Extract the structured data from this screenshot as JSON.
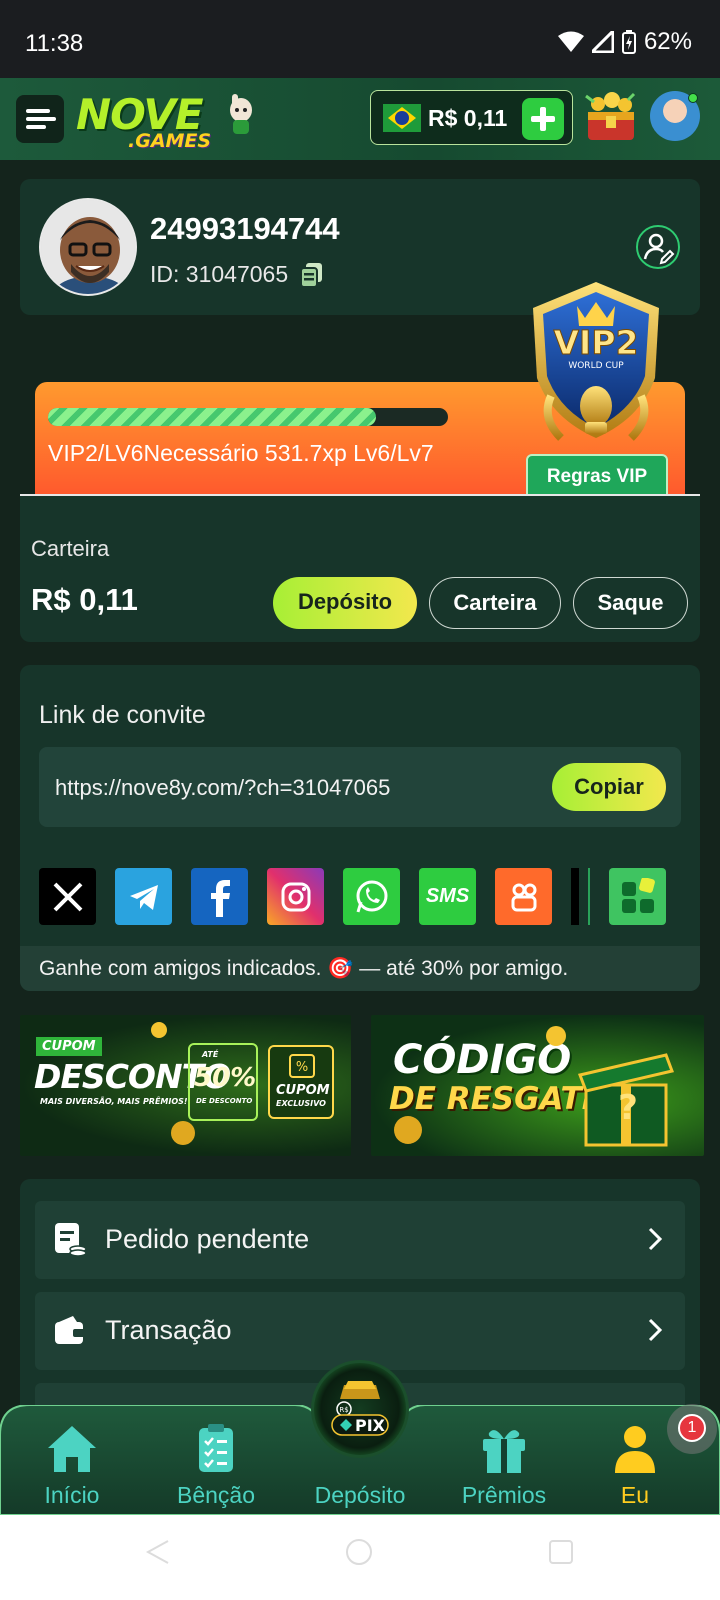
{
  "status_bar": {
    "time": "11:38",
    "battery": "62%"
  },
  "header": {
    "logo_main": "NOVE",
    "logo_sub": ".GAMES",
    "balance": "R$ 0,11"
  },
  "profile": {
    "username": "24993194744",
    "id_text": "ID: 31047065"
  },
  "vip": {
    "badge_label": "VIP2",
    "badge_sub": "WORLD CUP",
    "progress_fraction": 0.82,
    "progress_text": "VIP2/LV6Necessário 531.7xp Lv6/Lv7",
    "rules_label": "Regras VIP"
  },
  "wallet": {
    "title": "Carteira",
    "amount": "R$ 0,11",
    "buttons": {
      "deposit": "Depósito",
      "wallet": "Carteira",
      "withdraw": "Saque"
    }
  },
  "invite": {
    "title": "Link de convite",
    "link": "https://nove8y.com/?ch=31047065",
    "copy_label": "Copiar",
    "share_sms": "SMS",
    "footer": "Ganhe com amigos indicados. 🎯 — até 30% por amigo."
  },
  "banners": {
    "left": {
      "tag": "CUPOM",
      "title": "DESCONTO",
      "sub": "MAIS DIVERSÃO, MAIS PRÊMIOS!",
      "pct_prefix": "ATÉ",
      "pct": "50%",
      "pct_suffix": "DE DESCONTO",
      "coupon": "CUPOM",
      "coupon_sub": "EXCLUSIVO"
    },
    "right": {
      "line1": "CÓDIGO",
      "line2": "DE RESGATE"
    }
  },
  "menu": {
    "items": [
      {
        "label": "Pedido pendente"
      },
      {
        "label": "Transação"
      }
    ]
  },
  "bottom_nav": {
    "items": [
      {
        "label": "Início"
      },
      {
        "label": "Bênção"
      },
      {
        "label": "Depósito"
      },
      {
        "label": "Prêmios"
      },
      {
        "label": "Eu"
      }
    ],
    "active": "Eu",
    "pix_label": "PIX",
    "pix_currency": "R$",
    "notification_count": "1"
  },
  "colors": {
    "background": "#14241c",
    "card": "#17352a",
    "accent_green": "#2ecc40",
    "accent_yellow": "#ffcc1f",
    "nav_teal": "#4cd3c2",
    "vip_orange": "#ff7a2d"
  }
}
